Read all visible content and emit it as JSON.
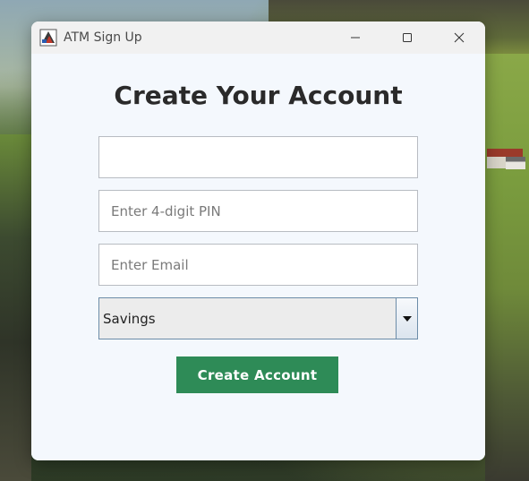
{
  "window": {
    "title": "ATM Sign Up",
    "app_icon": "java-app-icon",
    "controls": {
      "minimize_icon": "minimize-icon",
      "maximize_icon": "maximize-icon",
      "close_icon": "close-icon"
    }
  },
  "form": {
    "heading": "Create Your Account",
    "name_field": {
      "value": "",
      "placeholder": ""
    },
    "pin_field": {
      "value": "",
      "placeholder": "Enter 4-digit PIN"
    },
    "email_field": {
      "value": "",
      "placeholder": "Enter Email"
    },
    "account_type": {
      "selected": "Savings",
      "arrow_icon": "dropdown-arrow-icon"
    },
    "submit_label": "Create Account"
  },
  "colors": {
    "accent": "#2e8b57",
    "background": "#f4f8fd"
  }
}
